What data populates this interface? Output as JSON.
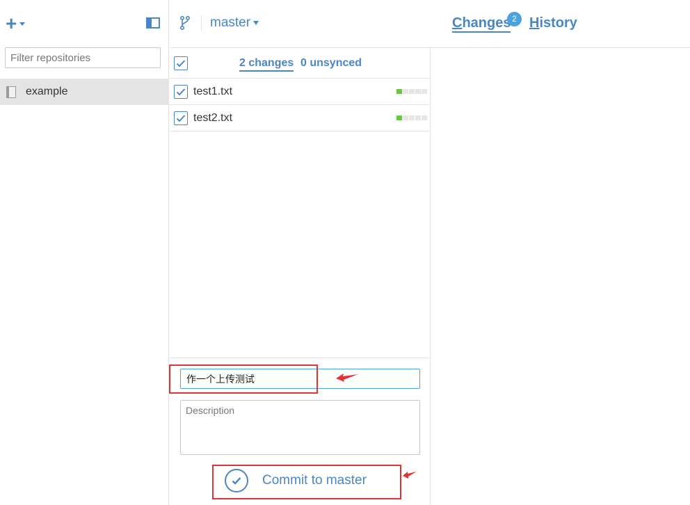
{
  "sidebar": {
    "filter_placeholder": "Filter repositories",
    "repositories": [
      {
        "label": "example",
        "selected": true,
        "icon": "repo-book-icon"
      }
    ]
  },
  "toolbar": {
    "add_icon": "plus-icon",
    "panel_toggle_icon": "sidebar-toggle-icon",
    "branch_icon": "git-branch-icon"
  },
  "branch": {
    "name": "master"
  },
  "view_tabs": {
    "changes_label": "Changes",
    "changes_badge": "2",
    "history_label": "History",
    "active": "Changes"
  },
  "changes_panel": {
    "changes_count_label": "2 changes",
    "unsynced_label": "0 unsynced",
    "files": [
      {
        "name": "test1.txt",
        "checked": true
      },
      {
        "name": "test2.txt",
        "checked": true
      }
    ]
  },
  "commit": {
    "summary_value": "作一个上传测试",
    "description_placeholder": "Description",
    "button_label": "Commit to master"
  },
  "colors": {
    "accent": "#4a86c5",
    "badge": "#4aa3df",
    "diff_added": "#6cc644",
    "annotation": "#e03434",
    "selected_row": "#e4e4e4"
  }
}
